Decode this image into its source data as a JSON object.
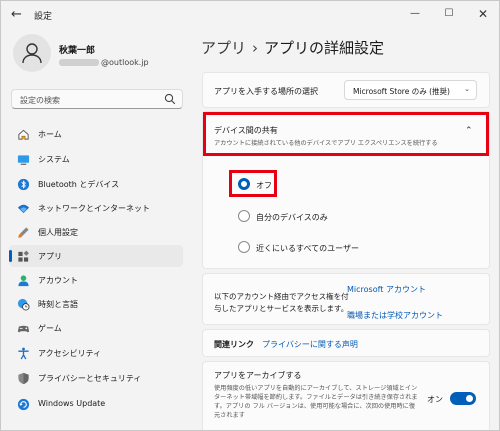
{
  "window": {
    "title": "設定",
    "minimize_glyph": "—",
    "maximize_glyph": "☐",
    "close_glyph": "✕",
    "back_glyph": "←"
  },
  "user": {
    "name": "秋葉一郎",
    "email_suffix": "@outlook.jp"
  },
  "search": {
    "placeholder": "設定の検索"
  },
  "sidebar": {
    "items": [
      {
        "label": "ホーム",
        "icon": "home-icon"
      },
      {
        "label": "システム",
        "icon": "system-icon"
      },
      {
        "label": "Bluetooth とデバイス",
        "icon": "bluetooth-icon"
      },
      {
        "label": "ネットワークとインターネット",
        "icon": "wifi-icon"
      },
      {
        "label": "個人用設定",
        "icon": "brush-icon"
      },
      {
        "label": "アプリ",
        "icon": "apps-icon",
        "active": true
      },
      {
        "label": "アカウント",
        "icon": "account-icon"
      },
      {
        "label": "時刻と言語",
        "icon": "globe-clock-icon"
      },
      {
        "label": "ゲーム",
        "icon": "gamepad-icon"
      },
      {
        "label": "アクセシビリティ",
        "icon": "accessibility-icon"
      },
      {
        "label": "プライバシーとセキュリティ",
        "icon": "shield-icon"
      },
      {
        "label": "Windows Update",
        "icon": "update-icon"
      }
    ]
  },
  "breadcrumb": {
    "parent": "アプリ",
    "separator": "›",
    "current": "アプリの詳細設定"
  },
  "app_source": {
    "label": "アプリを入手する場所の選択",
    "selected": "Microsoft Store のみ (推奨)"
  },
  "sharing": {
    "title": "デバイス間の共有",
    "description": "アカウントに接続されている他のデバイスでアプリ エクスペリエンスを続行する",
    "options": [
      {
        "label": "オフ",
        "selected": true
      },
      {
        "label": "自分のデバイスのみ",
        "selected": false
      },
      {
        "label": "近くにいるすべてのユーザー",
        "selected": false
      }
    ]
  },
  "account_access": {
    "text_line1": "以下のアカウント経由でアクセス権を付",
    "text_line2": "与したアプリとサービスを表示します。",
    "link_microsoft": "Microsoft アカウント",
    "link_work": "職場または学校アカウント"
  },
  "related": {
    "label": "関連リンク",
    "link": "プライバシーに関する声明"
  },
  "archive": {
    "title": "アプリをアーカイブする",
    "desc_line1": "使用頻度の低いアプリを自動的にアーカイブして、ストレージ領域とイン",
    "desc_line2": "ターネット帯域幅を節約します。ファイルとデータは引き続き保存されま",
    "desc_line3": "す。アプリの フル バージョンは、使用可能な場合に、次回の使用時に復",
    "desc_line4": "元されます",
    "toggle_label": "オン",
    "toggle_on": true
  },
  "colors": {
    "accent": "#005fb8",
    "highlight": "#e60012"
  }
}
